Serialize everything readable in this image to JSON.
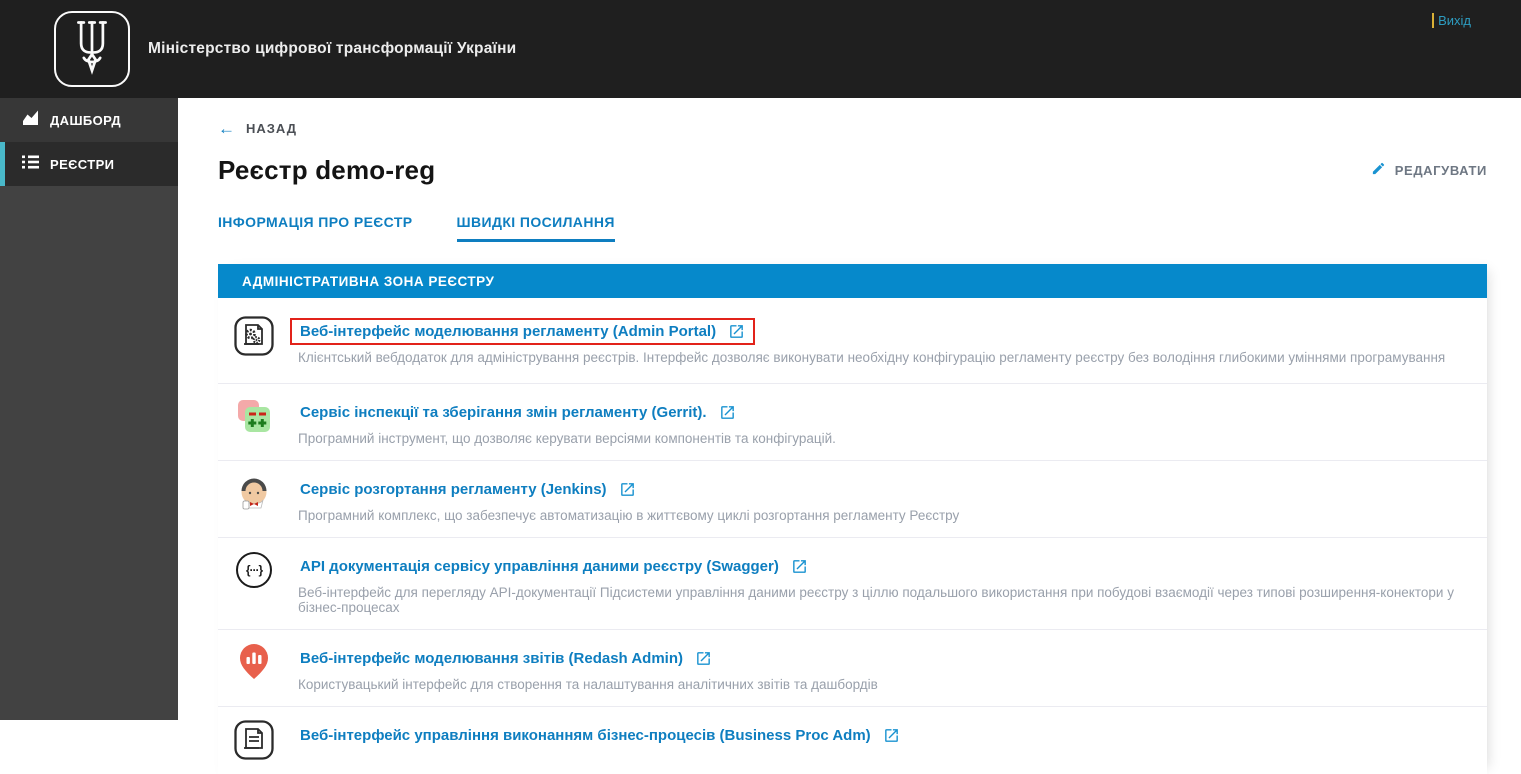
{
  "header": {
    "ministry_title": "Міністерство цифрової трансформації України",
    "logo_icon": "ukraine-trident-icon",
    "logout_label": "Вихід"
  },
  "sidebar": {
    "items": [
      {
        "label": "ДАШБОРД",
        "icon": "dashboard-chart-icon",
        "active": false
      },
      {
        "label": "РЕЄСТРИ",
        "icon": "registries-list-icon",
        "active": true
      }
    ]
  },
  "main": {
    "back_label": "НАЗАД",
    "back_icon": "back-arrow-icon",
    "page_title": "Реєстр demo-reg",
    "edit_label": "РЕДАГУВАТИ",
    "edit_icon": "edit-pencil-icon",
    "external_icon": "external-link-icon",
    "tabs": [
      {
        "label": "ІНФОРМАЦІЯ ПРО РЕЄСТР",
        "active": false
      },
      {
        "label": "ШВИДКІ ПОСИЛАННЯ",
        "active": true
      }
    ],
    "section_header": "АДМІНІСТРАТИВНА ЗОНА РЕЄСТРУ",
    "links": [
      {
        "title": "Веб-інтерфейс моделювання регламенту (Admin Portal)",
        "description": "Клієнтський вебдодаток для адміністрування реєстрів. Інтерфейс дозволяє виконувати необхідну конфігурацію регламенту реєстру без володіння глибокими уміннями програмування",
        "icon": "scroll-gears-icon",
        "highlighted": true
      },
      {
        "title": "Сервіс інспекції та зберігання змін регламенту (Gerrit).",
        "description": "Програмний інструмент, що дозволяє керувати версіями компонентів та конфігурацій.",
        "icon": "gerrit-diff-icon",
        "highlighted": false
      },
      {
        "title": "Сервіс розгортання регламенту (Jenkins)",
        "description": "Програмний комплекс, що забезпечує автоматизацію в життєвому циклі розгортання регламенту Реєстру",
        "icon": "jenkins-butler-icon",
        "highlighted": false
      },
      {
        "title": "API документація сервісу управління даними реєстру (Swagger)",
        "description": "Веб-інтерфейс для перегляду API-документації Підсистеми управління даними реєстру з ціллю подальшого використання при побудові взаємодії через типові розширення-конектори у бізнес-процесах",
        "icon": "swagger-braces-icon",
        "highlighted": false
      },
      {
        "title": "Веб-інтерфейс моделювання звітів (Redash Admin)",
        "description": "Користувацький інтерфейс для створення та налаштування аналітичних звітів та дашбордів",
        "icon": "redash-chart-pin-icon",
        "highlighted": false
      },
      {
        "title": "Веб-інтерфейс управління виконанням бізнес-процесів (Business Proc Adm)",
        "description": "",
        "icon": "scroll-icon",
        "highlighted": false
      }
    ]
  },
  "colors": {
    "accent_blue": "#0689CB",
    "link_blue": "#0E7EC0",
    "icon_blue": "#1A93D1",
    "logout_cyan": "#2D9CC0",
    "logout_bar_yellow": "#D9B036",
    "highlight_red": "#E2231A",
    "sidebar_active_accent": "#49B8C9",
    "topbar_black": "#1F1F1F",
    "sidebar_gray": "#424242",
    "description_gray": "#99A0AB"
  }
}
